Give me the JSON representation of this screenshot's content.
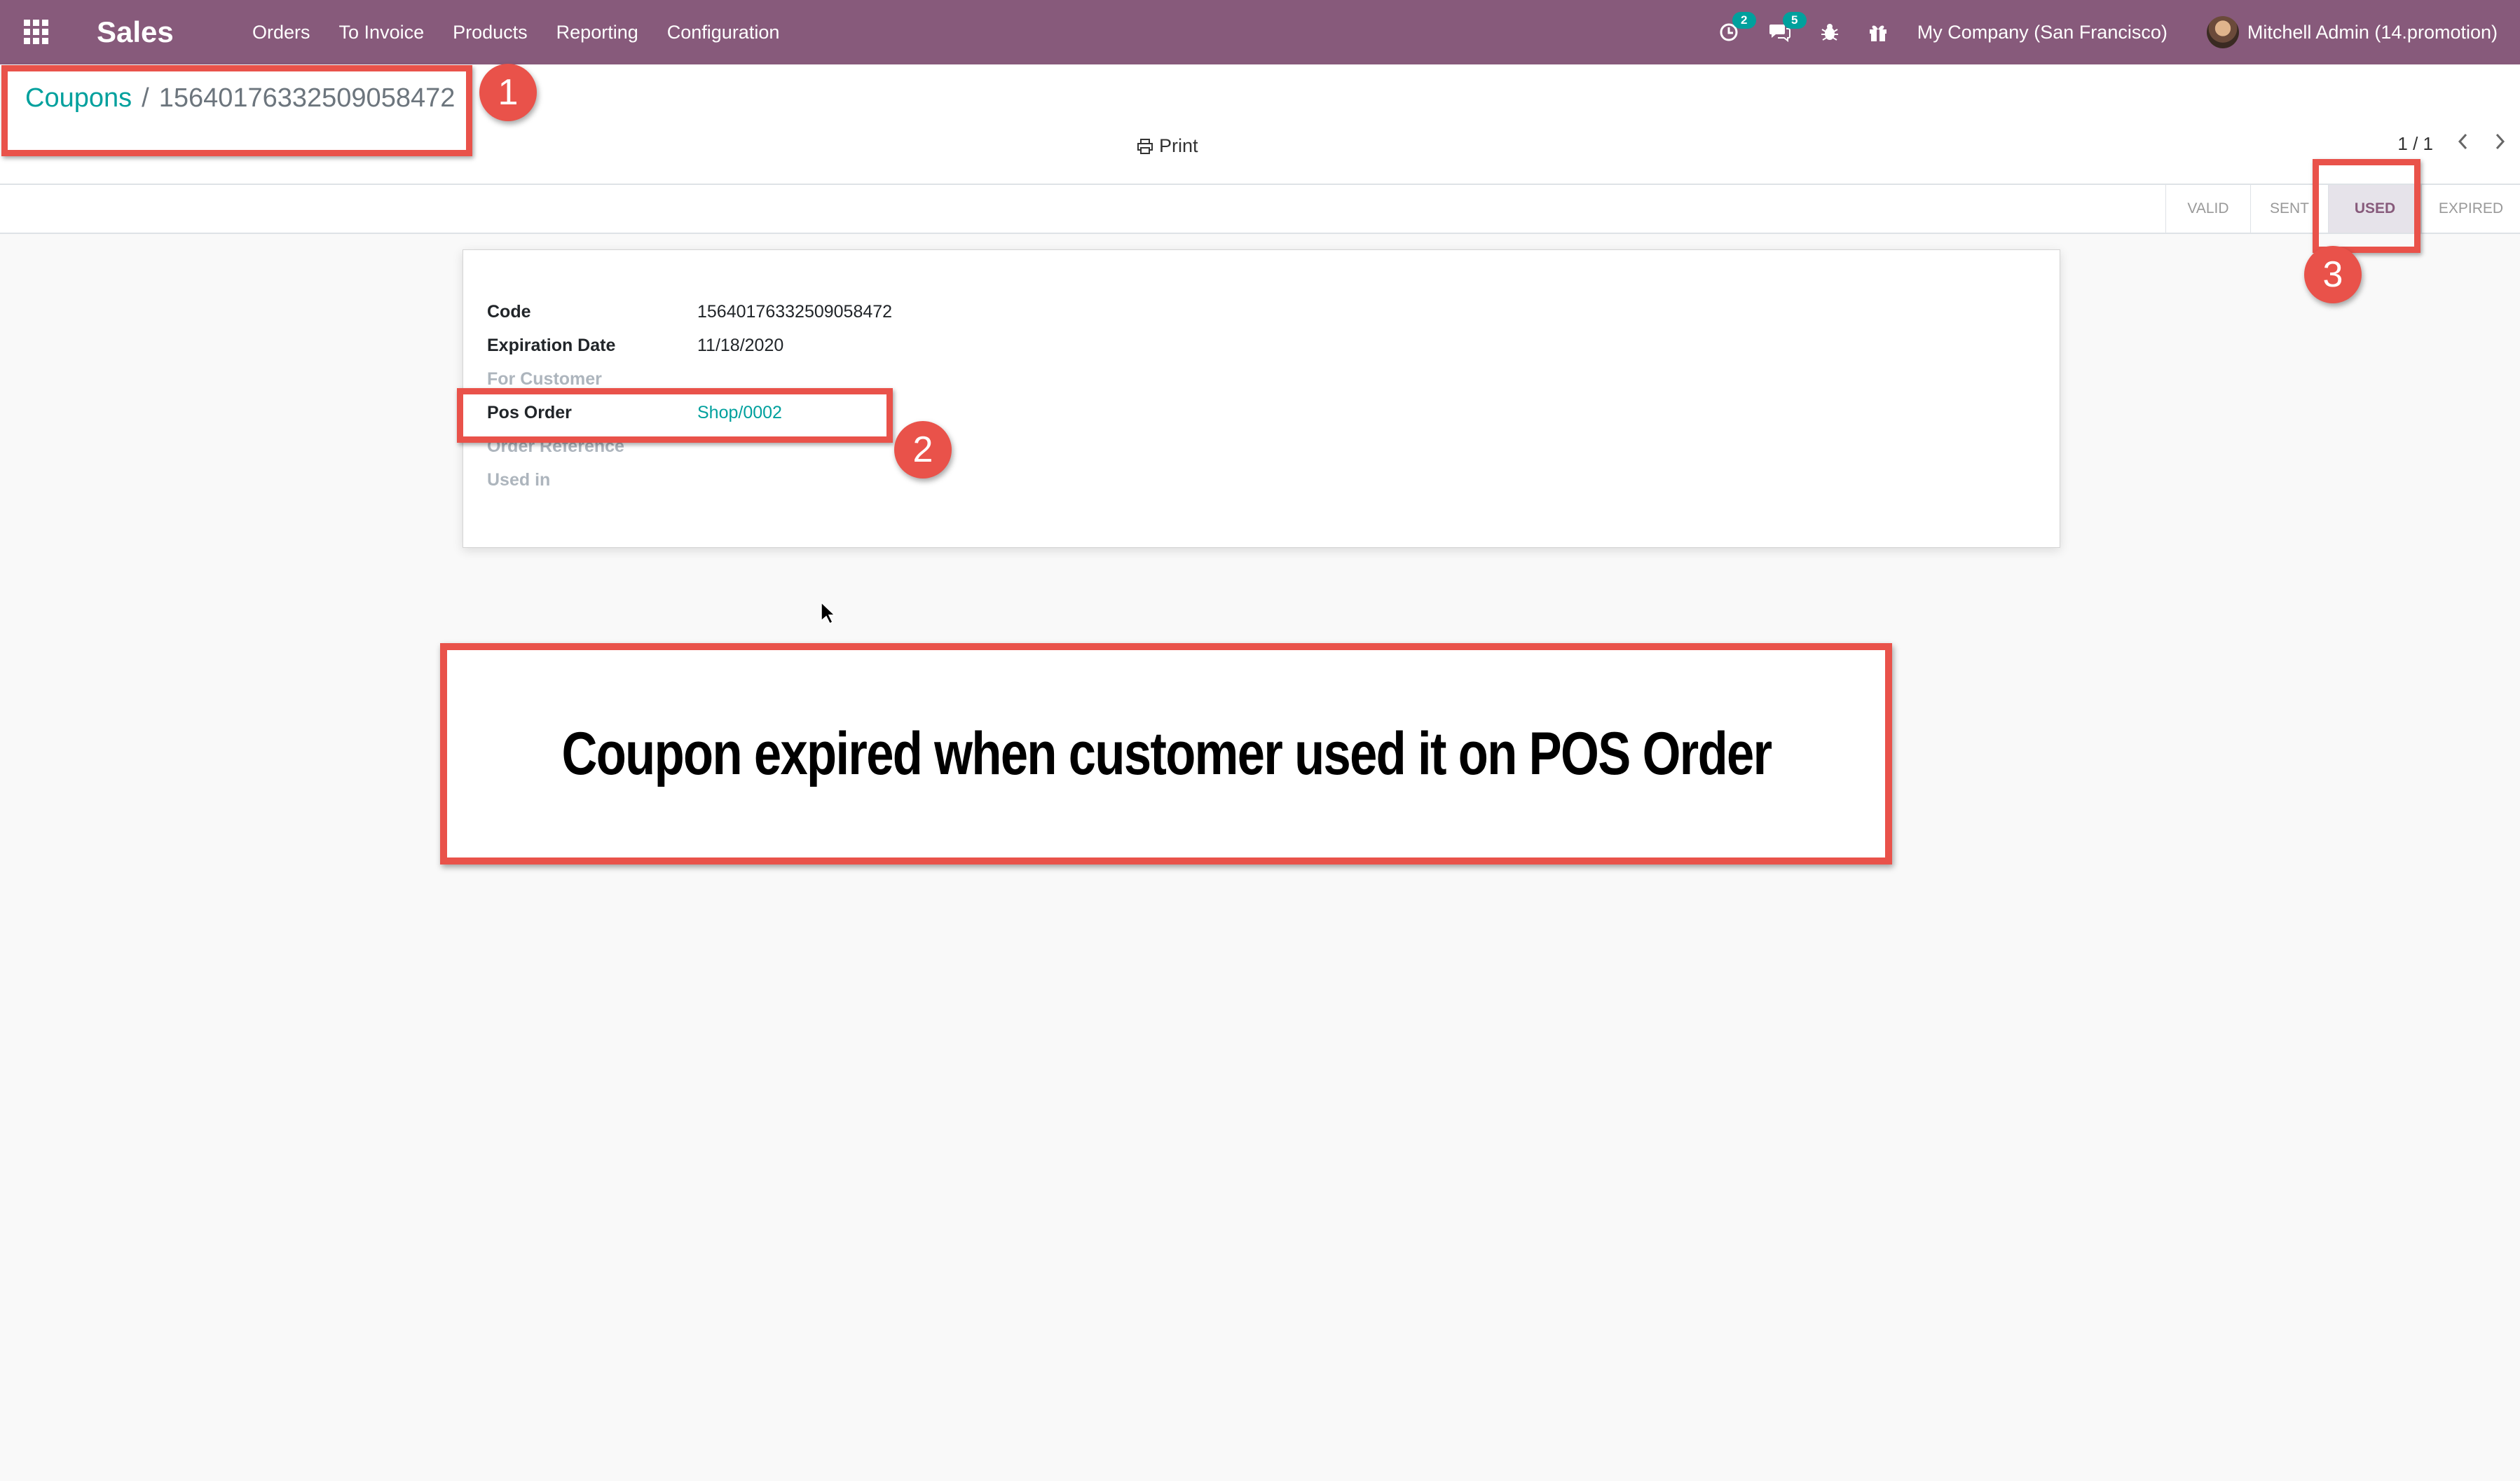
{
  "navbar": {
    "app_name": "Sales",
    "menu": [
      "Orders",
      "To Invoice",
      "Products",
      "Reporting",
      "Configuration"
    ],
    "activity_badge": "2",
    "messages_badge": "5",
    "company": "My Company (San Francisco)",
    "user": "Mitchell Admin (14.promotion)",
    "bg_color": "#875a7b"
  },
  "breadcrumb": {
    "parent": "Coupons",
    "separator": "/",
    "current": "15640176332509058472"
  },
  "control_panel": {
    "print_label": "Print",
    "pager": "1 / 1"
  },
  "statusbar": {
    "steps": [
      "VALID",
      "SENT",
      "USED",
      "EXPIRED"
    ],
    "active_step": "USED"
  },
  "form": {
    "fields": [
      {
        "label": "Code",
        "value": "15640176332509058472"
      },
      {
        "label": "Expiration Date",
        "value": "11/18/2020"
      },
      {
        "label": "For Customer",
        "value": ""
      },
      {
        "label": "Pos Order",
        "value": "Shop/0002"
      },
      {
        "label": "Order Reference",
        "value": ""
      },
      {
        "label": "Used in",
        "value": ""
      }
    ]
  },
  "annotations": {
    "markers": [
      "1",
      "2",
      "3"
    ],
    "caption": "Coupon expired when customer used it on POS Order",
    "color": "#e9524a"
  }
}
